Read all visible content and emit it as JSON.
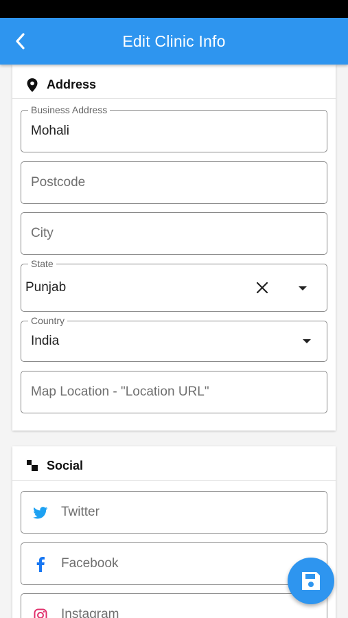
{
  "header": {
    "title": "Edit Clinic Info",
    "back_icon": "chevron-left-icon"
  },
  "address": {
    "section_title": "Address",
    "section_icon": "location-pin-icon",
    "business_address": {
      "label": "Business Address",
      "value": "Mohali"
    },
    "postcode": {
      "placeholder": "Postcode"
    },
    "city": {
      "placeholder": "City"
    },
    "state": {
      "label": "State",
      "value": "Punjab"
    },
    "country": {
      "label": "Country",
      "value": "India"
    },
    "map_location": {
      "placeholder": "Map Location - \"Location URL\""
    }
  },
  "social": {
    "section_title": "Social",
    "section_icon": "social-grid-icon",
    "twitter": {
      "placeholder": "Twitter",
      "icon": "twitter-icon"
    },
    "facebook": {
      "placeholder": "Facebook",
      "icon": "facebook-icon"
    },
    "instagram": {
      "placeholder": "Instagram",
      "icon": "instagram-icon"
    }
  },
  "fab": {
    "icon": "save-icon"
  },
  "colors": {
    "primary": "#2e95ef",
    "twitter": "#1da1f2",
    "facebook": "#1877f2",
    "instagram": "#e1306c"
  }
}
